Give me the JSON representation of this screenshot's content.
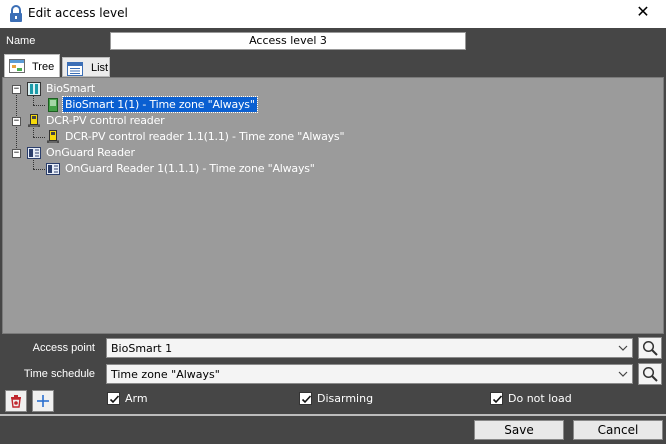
{
  "window": {
    "title": "Edit access level",
    "close_glyph": "✕",
    "icon": "lock-icon"
  },
  "name_field": {
    "label": "Name",
    "value": "Access level 3"
  },
  "tabs": [
    {
      "label": "Tree",
      "icon": "tree-view-icon",
      "active": true
    },
    {
      "label": "List",
      "icon": "list-view-icon",
      "active": false
    }
  ],
  "tree": {
    "groups": [
      {
        "label": "BioSmart",
        "icon": "biosmart-icon",
        "expander": "−",
        "children": [
          {
            "label": "BioSmart 1(1) - Time zone \"Always\"",
            "icon": "biosmart-device-icon",
            "selected": true
          }
        ]
      },
      {
        "label": "DCR-PV control reader",
        "icon": "dcr-reader-icon",
        "expander": "−",
        "children": [
          {
            "label": "DCR-PV control reader 1.1(1.1) - Time zone \"Always\"",
            "icon": "dcr-reader-device-icon",
            "selected": false
          }
        ]
      },
      {
        "label": "OnGuard Reader",
        "icon": "onguard-reader-icon",
        "expander": "−",
        "children": [
          {
            "label": "OnGuard Reader 1(1.1.1) - Time zone \"Always\"",
            "icon": "onguard-reader-device-icon",
            "selected": false
          }
        ]
      }
    ]
  },
  "access_point": {
    "label": "Access point",
    "value": "BioSmart 1"
  },
  "time_schedule": {
    "label": "Time schedule",
    "value": "Time zone \"Always\""
  },
  "checkboxes": [
    {
      "label": "Arm",
      "checked": true
    },
    {
      "label": "Disarming",
      "checked": true
    },
    {
      "label": "Do not load",
      "checked": true
    }
  ],
  "buttons": {
    "save": "Save",
    "cancel": "Cancel"
  },
  "colors": {
    "tree_bg": "#9b9b9b",
    "dialog_bg": "#464646",
    "selection": "#0a5fd1",
    "delete_icon": "#c0262d",
    "add_icon": "#2a6fcf"
  }
}
